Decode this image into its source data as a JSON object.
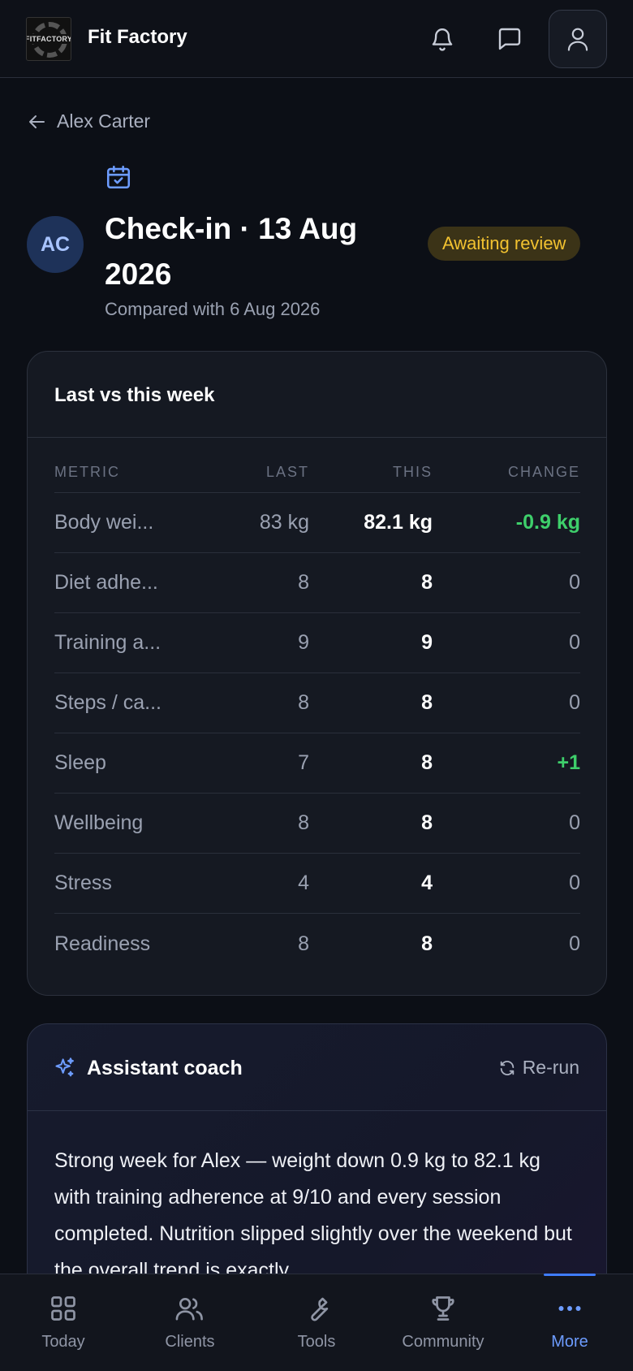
{
  "header": {
    "logo_text": "FITFACTORY",
    "brand": "Fit Factory",
    "icons": [
      "bell-icon",
      "chat-icon",
      "user-icon"
    ]
  },
  "back": {
    "label": "Alex Carter"
  },
  "checkin": {
    "avatar_initials": "AC",
    "title": "Check-in · 13 Aug 2026",
    "subtitle": "Compared with 6 Aug 2026",
    "status": "Awaiting review"
  },
  "comparison": {
    "heading": "Last vs this week",
    "columns": {
      "metric": "METRIC",
      "last": "LAST",
      "this": "THIS",
      "change": "CHANGE"
    },
    "rows": [
      {
        "metric": "Body wei...",
        "last": "83 kg",
        "this": "82.1 kg",
        "change": "-0.9 kg"
      },
      {
        "metric": "Diet adhe...",
        "last": "8",
        "this": "8",
        "change": "0"
      },
      {
        "metric": "Training a...",
        "last": "9",
        "this": "9",
        "change": "0"
      },
      {
        "metric": "Steps / ca...",
        "last": "8",
        "this": "8",
        "change": "0"
      },
      {
        "metric": "Sleep",
        "last": "7",
        "this": "8",
        "change": "+1"
      },
      {
        "metric": "Wellbeing",
        "last": "8",
        "this": "8",
        "change": "0"
      },
      {
        "metric": "Stress",
        "last": "4",
        "this": "4",
        "change": "0"
      },
      {
        "metric": "Readiness",
        "last": "8",
        "this": "8",
        "change": "0"
      }
    ]
  },
  "assistant": {
    "title": "Assistant coach",
    "rerun_label": "Re-run",
    "body": "Strong week for Alex — weight down 0.9 kg to 82.1 kg with training adherence at 9/10 and every session completed. Nutrition slipped slightly over the weekend but the overall trend is exactly"
  },
  "nav": {
    "items": [
      {
        "label": "Today",
        "icon": "grid-icon"
      },
      {
        "label": "Clients",
        "icon": "users-icon"
      },
      {
        "label": "Tools",
        "icon": "wrench-icon"
      },
      {
        "label": "Community",
        "icon": "trophy-icon"
      },
      {
        "label": "More",
        "icon": "more-icon"
      }
    ],
    "active": "More"
  },
  "colors": {
    "background": "#0c0f16",
    "accent": "#6d9cff",
    "positive": "#3ecf6b",
    "badge_text": "#f2c230",
    "badge_bg": "#3b3317"
  }
}
